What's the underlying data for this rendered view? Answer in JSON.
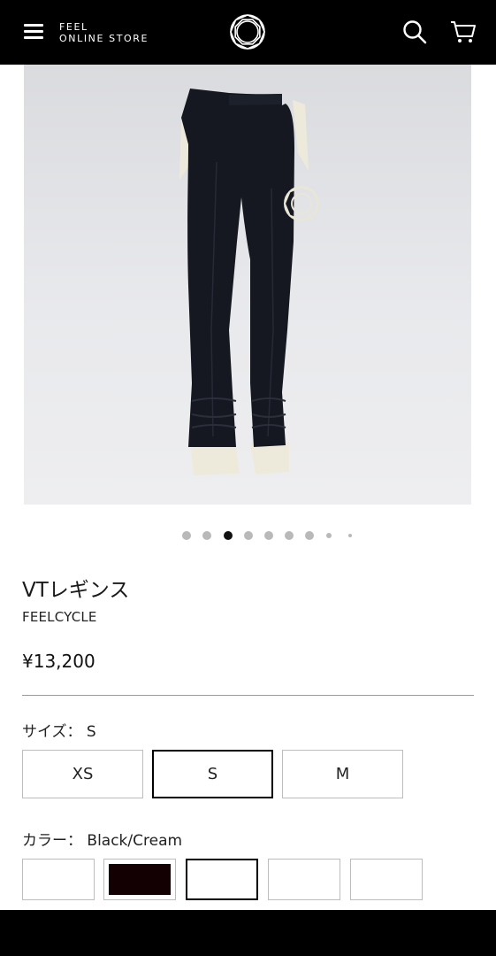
{
  "header": {
    "brand_line1": "FEEL",
    "brand_line2": "ONLINE STORE",
    "icons": [
      "menu-icon",
      "brand-logo-icon",
      "search-icon",
      "cart-icon"
    ]
  },
  "gallery": {
    "dot_count": 9,
    "active_index": 2
  },
  "product": {
    "title": "VTレギンス",
    "brand": "FEELCYCLE",
    "price": "¥13,200"
  },
  "size": {
    "label": "サイズ： S",
    "options": [
      "XS",
      "S",
      "M"
    ],
    "selected": "S"
  },
  "color": {
    "label": "カラー： Black/Cream",
    "swatches": [
      "#ffffff",
      "#120002",
      "#ffffff",
      "#ffffff",
      "#ffffff"
    ],
    "selected_index": 2
  },
  "colors": {
    "header_bg": "#000000",
    "accent": "#000000",
    "pants": "#151820",
    "cuff_cream": "#eeeadb"
  }
}
